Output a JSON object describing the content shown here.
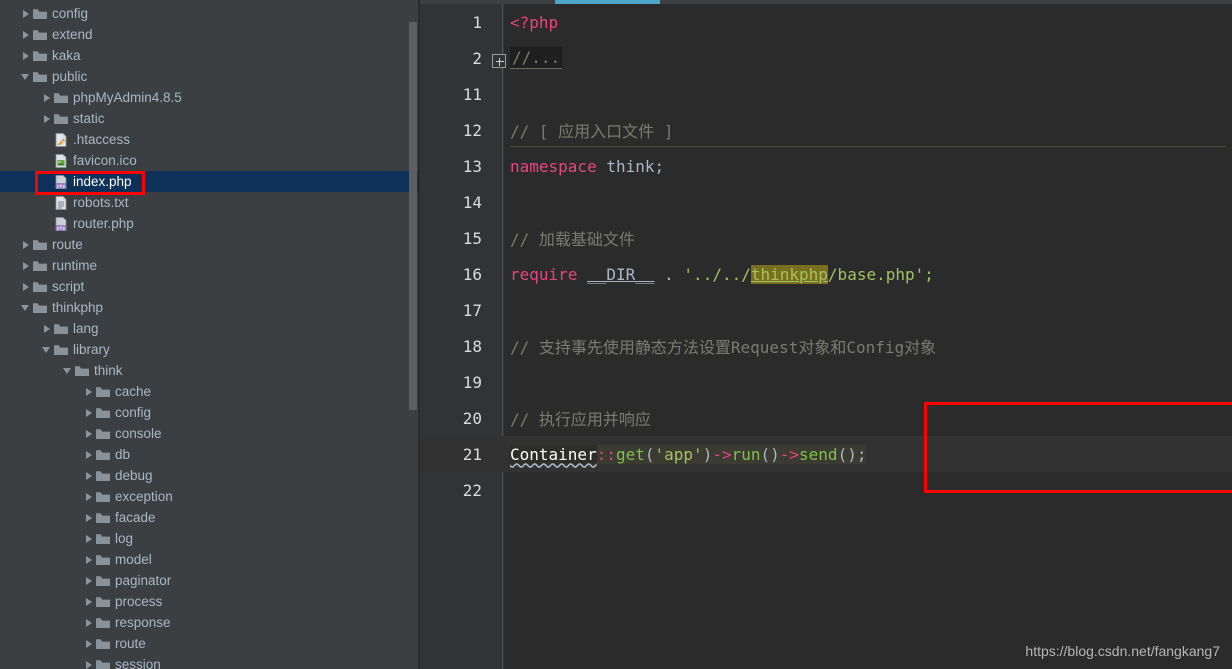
{
  "sidebar": {
    "scrollbar": {
      "name": "project-tree-scrollbar"
    },
    "selected_item": "index.php",
    "items": [
      {
        "label": "config",
        "indent": 0,
        "type": "folder",
        "state": "closed",
        "icon": "folder-icon"
      },
      {
        "label": "extend",
        "indent": 0,
        "type": "folder",
        "state": "closed",
        "icon": "folder-icon"
      },
      {
        "label": "kaka",
        "indent": 0,
        "type": "folder",
        "state": "closed",
        "icon": "folder-icon"
      },
      {
        "label": "public",
        "indent": 0,
        "type": "folder",
        "state": "open",
        "icon": "folder-icon"
      },
      {
        "label": "phpMyAdmin4.8.5",
        "indent": 1,
        "type": "folder",
        "state": "closed",
        "icon": "folder-icon"
      },
      {
        "label": "static",
        "indent": 1,
        "type": "folder",
        "state": "closed",
        "icon": "folder-icon"
      },
      {
        "label": ".htaccess",
        "indent": 1,
        "type": "file",
        "state": "none",
        "icon": "htaccess-file-icon"
      },
      {
        "label": "favicon.ico",
        "indent": 1,
        "type": "file",
        "state": "none",
        "icon": "image-file-icon"
      },
      {
        "label": "index.php",
        "indent": 1,
        "type": "file",
        "state": "none",
        "icon": "php-file-icon",
        "selected": true
      },
      {
        "label": "robots.txt",
        "indent": 1,
        "type": "file",
        "state": "none",
        "icon": "text-file-icon"
      },
      {
        "label": "router.php",
        "indent": 1,
        "type": "file",
        "state": "none",
        "icon": "php-file-icon"
      },
      {
        "label": "route",
        "indent": 0,
        "type": "folder",
        "state": "closed",
        "icon": "folder-icon"
      },
      {
        "label": "runtime",
        "indent": 0,
        "type": "folder",
        "state": "closed",
        "icon": "folder-icon"
      },
      {
        "label": "script",
        "indent": 0,
        "type": "folder",
        "state": "closed",
        "icon": "folder-icon"
      },
      {
        "label": "thinkphp",
        "indent": 0,
        "type": "folder",
        "state": "open",
        "icon": "folder-icon"
      },
      {
        "label": "lang",
        "indent": 1,
        "type": "folder",
        "state": "closed",
        "icon": "folder-icon"
      },
      {
        "label": "library",
        "indent": 1,
        "type": "folder",
        "state": "open",
        "icon": "folder-icon"
      },
      {
        "label": "think",
        "indent": 2,
        "type": "folder",
        "state": "open",
        "icon": "folder-icon"
      },
      {
        "label": "cache",
        "indent": 3,
        "type": "folder",
        "state": "closed",
        "icon": "folder-icon"
      },
      {
        "label": "config",
        "indent": 3,
        "type": "folder",
        "state": "closed",
        "icon": "folder-icon"
      },
      {
        "label": "console",
        "indent": 3,
        "type": "folder",
        "state": "closed",
        "icon": "folder-icon"
      },
      {
        "label": "db",
        "indent": 3,
        "type": "folder",
        "state": "closed",
        "icon": "folder-icon"
      },
      {
        "label": "debug",
        "indent": 3,
        "type": "folder",
        "state": "closed",
        "icon": "folder-icon"
      },
      {
        "label": "exception",
        "indent": 3,
        "type": "folder",
        "state": "closed",
        "icon": "folder-icon"
      },
      {
        "label": "facade",
        "indent": 3,
        "type": "folder",
        "state": "closed",
        "icon": "folder-icon"
      },
      {
        "label": "log",
        "indent": 3,
        "type": "folder",
        "state": "closed",
        "icon": "folder-icon"
      },
      {
        "label": "model",
        "indent": 3,
        "type": "folder",
        "state": "closed",
        "icon": "folder-icon"
      },
      {
        "label": "paginator",
        "indent": 3,
        "type": "folder",
        "state": "closed",
        "icon": "folder-icon"
      },
      {
        "label": "process",
        "indent": 3,
        "type": "folder",
        "state": "closed",
        "icon": "folder-icon"
      },
      {
        "label": "response",
        "indent": 3,
        "type": "folder",
        "state": "closed",
        "icon": "folder-icon"
      },
      {
        "label": "route",
        "indent": 3,
        "type": "folder",
        "state": "closed",
        "icon": "folder-icon"
      },
      {
        "label": "session",
        "indent": 3,
        "type": "folder",
        "state": "closed",
        "icon": "folder-icon"
      }
    ]
  },
  "editor": {
    "fold_marker": "+",
    "lines": [
      {
        "num": "1",
        "text": "<?php"
      },
      {
        "num": "2",
        "text": "//..."
      },
      {
        "num": "11",
        "text": ""
      },
      {
        "num": "12",
        "text": "// [ 应用入口文件 ]"
      },
      {
        "num": "13",
        "text": "namespace think;"
      },
      {
        "num": "14",
        "text": ""
      },
      {
        "num": "15",
        "text": "// 加载基础文件"
      },
      {
        "num": "16",
        "text": "require __DIR__ . '../../thinkphp/base.php';"
      },
      {
        "num": "17",
        "text": ""
      },
      {
        "num": "18",
        "text": "// 支持事先使用静态方法设置Request对象和Config对象"
      },
      {
        "num": "19",
        "text": ""
      },
      {
        "num": "20",
        "text": "// 执行应用并响应"
      },
      {
        "num": "21",
        "text": "Container::get('app')->run()->send();"
      },
      {
        "num": "22",
        "text": ""
      }
    ],
    "tokens": {
      "php_open": "<?php",
      "fold_text": "//...",
      "cmt12": "// [ 应用入口文件 ]",
      "kw_namespace": "namespace",
      "ns_think": " think;",
      "cmt15": "// 加载基础文件",
      "kw_require": "require",
      "dir_const": "__DIR__",
      "concat": " . ",
      "str_open": "'../../",
      "str_link": "thinkphp",
      "str_rest": "/base.php';",
      "cmt18": "// 支持事先使用静态方法设置Request对象和Config对象",
      "cmt20": "// 执行应用并响应",
      "container": "Container",
      "dcolon": "::",
      "get": "get",
      "paren_open": "(",
      "app_str": "'app'",
      "paren_close": ")",
      "arrow1": "->",
      "run": "run",
      "run_parens": "()",
      "arrow2": "->",
      "send": "send",
      "send_parens": "();"
    }
  },
  "annotations": {
    "index_box_color": "#ff0000",
    "code_box_color": "#ff0000"
  },
  "watermark": "https://blog.csdn.net/fangkang7",
  "colors": {
    "sidebar_bg": "#3c3f41",
    "editor_bg": "#2b2b2b",
    "gutter_bg": "#313335",
    "selection_blue": "#0d3158",
    "tab_accent": "#4ba6c9",
    "keyword": "#cc7832",
    "php_tag": "#e8457f",
    "string": "#a5c261",
    "comment": "#808080",
    "text": "#a9b7c6",
    "link_highlight": "#7a6f1e"
  }
}
